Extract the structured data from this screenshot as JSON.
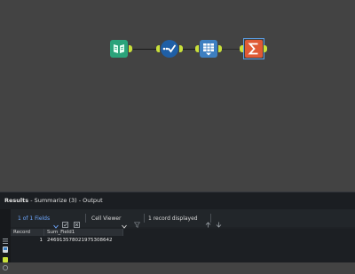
{
  "results": {
    "title_bold": "Results",
    "title_rest": " - Summarize (3) - Output"
  },
  "toolbar": {
    "fields_label": "1 of 1 Fields",
    "viewer_label": "Cell Viewer",
    "records_label": "1 record displayed"
  },
  "table": {
    "columns": [
      "Record",
      "Sum_Field1"
    ],
    "rows": [
      {
        "record": "1",
        "value": "246913578021975308642"
      }
    ]
  },
  "colors": {
    "canvas": "#434343",
    "input_tool": "#2aa37a",
    "formula_tool": "#1f5fa6",
    "browse_tool": "#3d7fc1",
    "summarize_tool": "#e05a35",
    "anchor": "#c9e03a",
    "link_blue": "#5aa0e8"
  },
  "icons": {
    "input": "book-icon",
    "formula": "check-flow-icon",
    "browse": "table-icon",
    "summarize": "sigma-icon"
  }
}
